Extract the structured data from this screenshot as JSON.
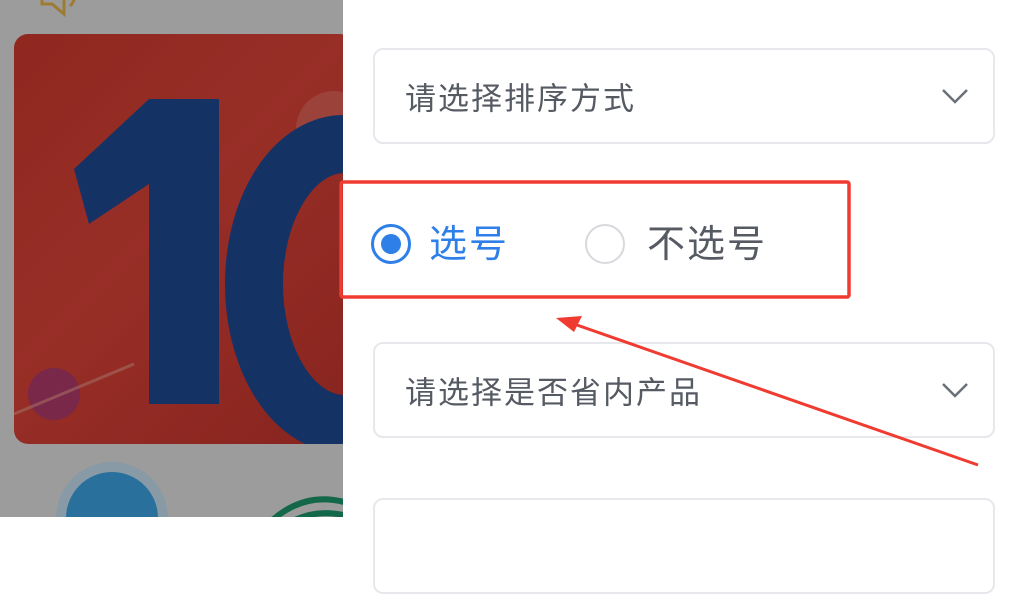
{
  "sort_select": {
    "placeholder": "请选择排序方式"
  },
  "number_choice": {
    "options": [
      {
        "label": "选号",
        "checked": true
      },
      {
        "label": "不选号",
        "checked": false
      }
    ]
  },
  "province_select": {
    "placeholder": "请选择是否省内产品"
  },
  "colors": {
    "accent": "#2f7fe8",
    "annotation": "#f03b30",
    "border": "#e6e8ec",
    "text_muted": "#555a63"
  },
  "icons": {
    "sort_chevron": "chevron-down-icon",
    "province_chevron": "chevron-down-icon",
    "speaker": "speaker-icon"
  }
}
